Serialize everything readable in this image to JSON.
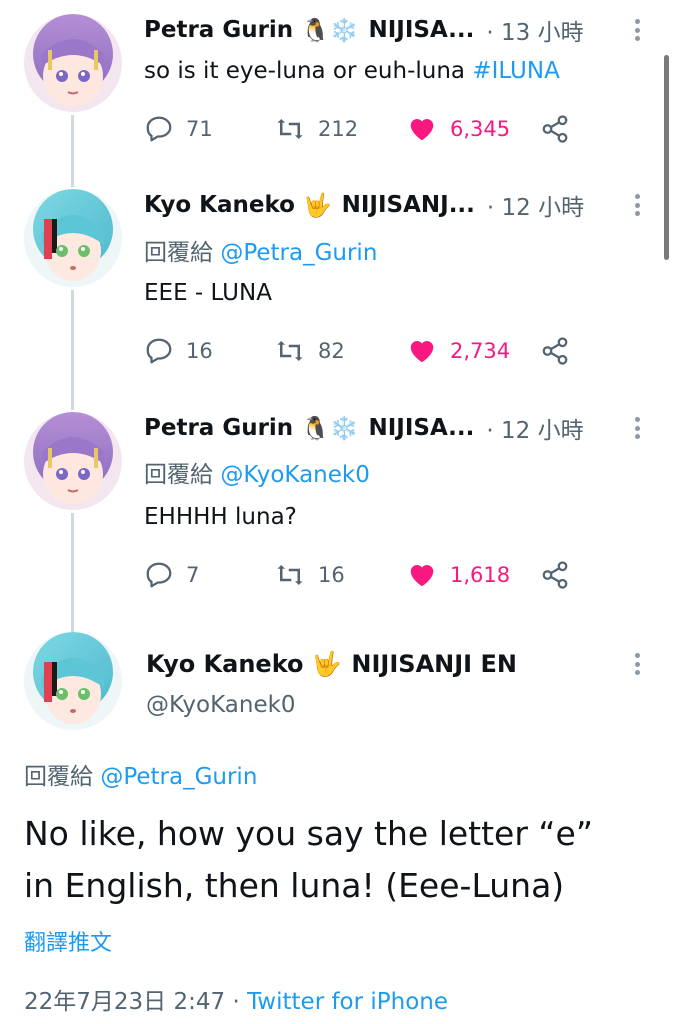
{
  "thread": [
    {
      "author": "Petra Gurin",
      "badges": "🐧❄️",
      "org": "NIJISA...",
      "time": "· 13 小時",
      "reply_to_label": "",
      "reply_to": "",
      "text": "so is it eye-luna or euh-luna ",
      "hashtag": "#ILUNA",
      "replies": "71",
      "retweets": "212",
      "likes": "6,345"
    },
    {
      "author": "Kyo Kaneko",
      "badges": "🤟",
      "org": "NIJISANJ...",
      "time": "· 12 小時",
      "reply_to_label": "回覆給 ",
      "reply_to": "@Petra_Gurin",
      "text": "EEE - LUNA",
      "replies": "16",
      "retweets": "82",
      "likes": "2,734"
    },
    {
      "author": "Petra Gurin",
      "badges": "🐧❄️",
      "org": "NIJISA...",
      "time": "· 12 小時",
      "reply_to_label": "回覆給 ",
      "reply_to": "@KyoKanek0",
      "text": "EHHHH luna?",
      "replies": "7",
      "retweets": "16",
      "likes": "1,618"
    }
  ],
  "main": {
    "author": "Kyo Kaneko",
    "badges": "🤟",
    "org": "NIJISANJI EN",
    "handle": "@KyoKanek0",
    "reply_to_label": "回覆給 ",
    "reply_to": "@Petra_Gurin",
    "text_line1": "No like, how you say the letter “e”",
    "text_line2": "in English, then luna! (Eee-Luna)",
    "translate": "翻譯推文",
    "timestamp": "22年7月23日 2:47 · ",
    "client": "Twitter for iPhone"
  },
  "colors": {
    "link": "#1d9bf0",
    "like": "#f91880",
    "muted": "#536471"
  },
  "icons": [
    "reply-icon",
    "retweet-icon",
    "heart-icon",
    "share-icon",
    "more-icon"
  ]
}
